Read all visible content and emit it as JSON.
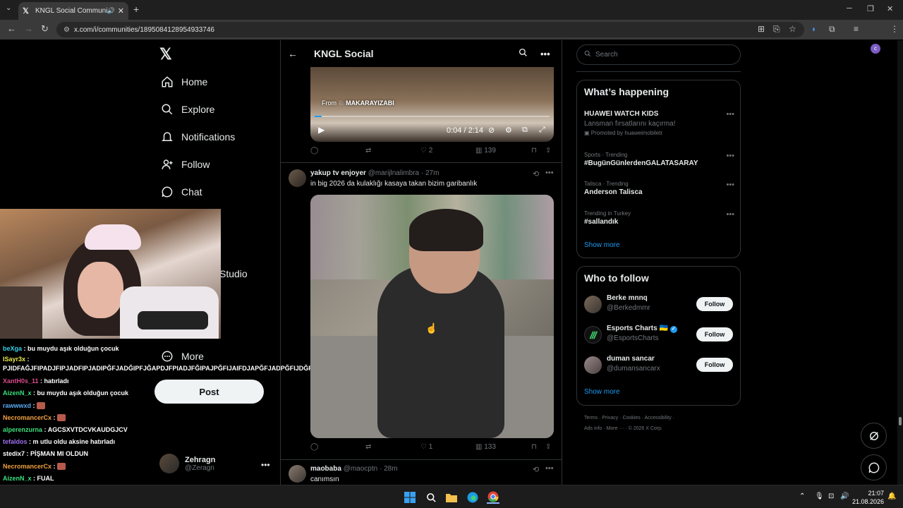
{
  "browser": {
    "tab_title": "KNGL Social Community / X",
    "url": "x.com/i/communities/1895084128954933746"
  },
  "nav": {
    "items": [
      {
        "label": "Home"
      },
      {
        "label": "Explore"
      },
      {
        "label": "Notifications"
      },
      {
        "label": "Follow"
      },
      {
        "label": "Chat"
      }
    ],
    "studio_fragment": "Studio",
    "more_label": "More",
    "post_label": "Post",
    "profile": {
      "name": "Zehragn",
      "handle": "@Zeragn"
    }
  },
  "chat_overlay": [
    {
      "user": "beXga",
      "color": "#3ad1e8",
      "msg": "bu muydu aşık olduğun çocuk"
    },
    {
      "user": "ISayr3x",
      "color": "#e8e84a",
      "msg": "PJIDFAĞJFIPADJFIPJADFIPJADIPĞFJADĞIPFJĞAPDJFPIADJFĞIPAJPĞFIJAIFDJAPĞFJADPĞFIJDĞPFJADPĞIJFPAJIFPĞIADJIFPĞIADJFIPĞJADPĞI",
      "wrap": true
    },
    {
      "user": "XantH0s_11",
      "color": "#d94b8a",
      "msg": "hatırladı"
    },
    {
      "user": "AizenN_x",
      "color": "#3be07a",
      "msg": "bu muydu aşık olduğun çocuk"
    },
    {
      "user": "rawwwxd",
      "color": "#5aa8f0",
      "msg": "",
      "emote": true
    },
    {
      "user": "NecromancerCx",
      "color": "#f0a040",
      "msg": "",
      "emote": true
    },
    {
      "user": "alperenzurna",
      "color": "#3be07a",
      "msg": "AGCSXVTDCVKAUDGJCV"
    },
    {
      "user": "tefaldos",
      "color": "#a070f0",
      "msg": "m utlu oldu aksine hatırladı"
    },
    {
      "user": "stedix7",
      "color": "#ffffff",
      "msg": "PİŞMAN MI OLDUN"
    },
    {
      "user": "NecromancerCx",
      "color": "#f0a040",
      "msg": "",
      "emote": true
    },
    {
      "user": "AizenN_x",
      "color": "#3be07a",
      "msg": "FUAL"
    }
  ],
  "timeline": {
    "title": "KNGL Social",
    "video1": {
      "from_prefix": "From",
      "from_name": "MAKARAYIZABI",
      "time": "0:04 / 2:14",
      "progress": 0.03
    },
    "actions1": {
      "replies": "",
      "reposts": "",
      "likes": "2",
      "views": "139"
    },
    "tweet2": {
      "name": "yakup tv enjoyer",
      "handle": "@marijlnalimbra",
      "time": "· 27m",
      "text": "in big 2026 da kulaklığı kasaya takan bizim garibanlık"
    },
    "actions2": {
      "replies": "",
      "reposts": "",
      "likes": "1",
      "views": "133"
    },
    "tweet3": {
      "name": "maobaba",
      "handle": "@maocptn",
      "time": "· 28m",
      "text": "canımsın"
    }
  },
  "sidebar": {
    "search_placeholder": "Search",
    "whats_happening": "What’s happening",
    "trends": [
      {
        "meta": "",
        "name": "HUAWEI WATCH KIDS",
        "sub": "Lansman fırsatlarını kaçırma!",
        "promo": "Promoted by huaweimobiletr"
      },
      {
        "meta": "Sports · Trending",
        "name": "#BugünGünlerdenGALATASARAY",
        "sub": "",
        "promo": ""
      },
      {
        "meta": "Talisca · Trending",
        "name": "Anderson Talisca",
        "sub": "",
        "promo": ""
      },
      {
        "meta": "Trending in Turkey",
        "name": "#sallandık",
        "sub": "",
        "promo": ""
      }
    ],
    "show_more": "Show more",
    "who_to_follow": "Who to follow",
    "follow_label": "Follow",
    "suggestions": [
      {
        "name": "Berke mnnq",
        "handle": "@Berkedmmr"
      },
      {
        "name": "Esports Charts 🇺🇦",
        "handle": "@EsportsCharts"
      },
      {
        "name": "duman sancar",
        "handle": "@dumansancarx"
      }
    ],
    "footer_line1": "Terms  ·  Privacy  ·  Cookies  ·  Accessibility  ·",
    "footer_line2": "Ads info  ·  More ···  ·  © 2026 X Corp."
  },
  "taskbar": {
    "time": "21:07",
    "date": "21.08.2026"
  }
}
